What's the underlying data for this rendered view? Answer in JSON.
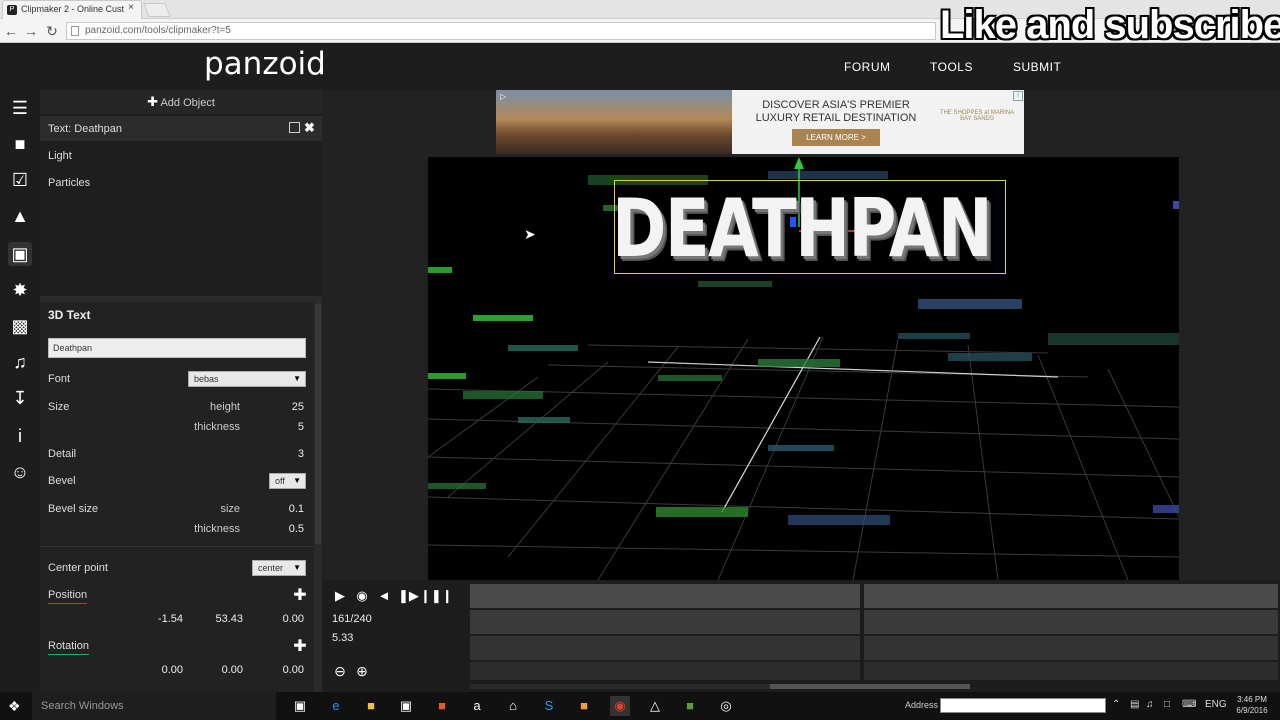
{
  "browser": {
    "tab_title": "Clipmaker 2 - Online Cust",
    "tab_close": "×",
    "url": "panzoid.com/tools/clipmaker?t=5",
    "back_icon": "arrow-left-icon",
    "forward_icon": "arrow-right-icon",
    "reload_icon": "reload-icon"
  },
  "overlay_text": "Like and subscribe",
  "site": {
    "logo": "panzoid",
    "nav": [
      "FORUM",
      "TOOLS",
      "SUBMIT"
    ]
  },
  "rail_icons": [
    "menu-icon",
    "folder-icon",
    "checkbox-icon",
    "image-icon",
    "cube-icon",
    "sparkle-icon",
    "camera-icon",
    "music-icon",
    "download-icon",
    "info-icon",
    "smiley-icon"
  ],
  "objects": {
    "add_label": "Add Object",
    "items": [
      "Text: Deathpan",
      "Light",
      "Particles"
    ]
  },
  "props": {
    "section": "3D Text",
    "text_value": "Deathpan",
    "font_label": "Font",
    "font_value": "bebas",
    "size_label": "Size",
    "height_label": "height",
    "height_value": "25",
    "thickness_label": "thickness",
    "thickness_value": "5",
    "detail_label": "Detail",
    "detail_value": "3",
    "bevel_label": "Bevel",
    "bevel_value": "off",
    "bevel_size_label": "Bevel size",
    "bevel_size_sub": "size",
    "bevel_size_value": "0.1",
    "bevel_thickness_label": "thickness",
    "bevel_thickness_value": "0.5",
    "center_label": "Center point",
    "center_value": "center",
    "position_label": "Position",
    "position": [
      "-1.54",
      "53.43",
      "0.00"
    ],
    "rotation_label": "Rotation",
    "rotation": [
      "0.00",
      "0.00",
      "0.00"
    ]
  },
  "ad": {
    "headline": "DISCOVER ASIA'S PREMIER LUXURY RETAIL DESTINATION",
    "cta": "LEARN MORE >",
    "brand": "THE SHOPPES at MARINA BAY SANDS"
  },
  "viewport": {
    "title_text": "DEATHPAN"
  },
  "timeline": {
    "frame": "161/240",
    "time": "5.33"
  },
  "taskbar": {
    "search_placeholder": "Search Windows",
    "address_label": "Address",
    "lang": "ENG",
    "time": "3:46 PM",
    "date": "6/9/2016"
  },
  "colors": {
    "position_accent": "#c0392b",
    "rotation_accent": "#27ae60",
    "bbox": "#d9d04a",
    "ad_cta": "#a98350"
  }
}
